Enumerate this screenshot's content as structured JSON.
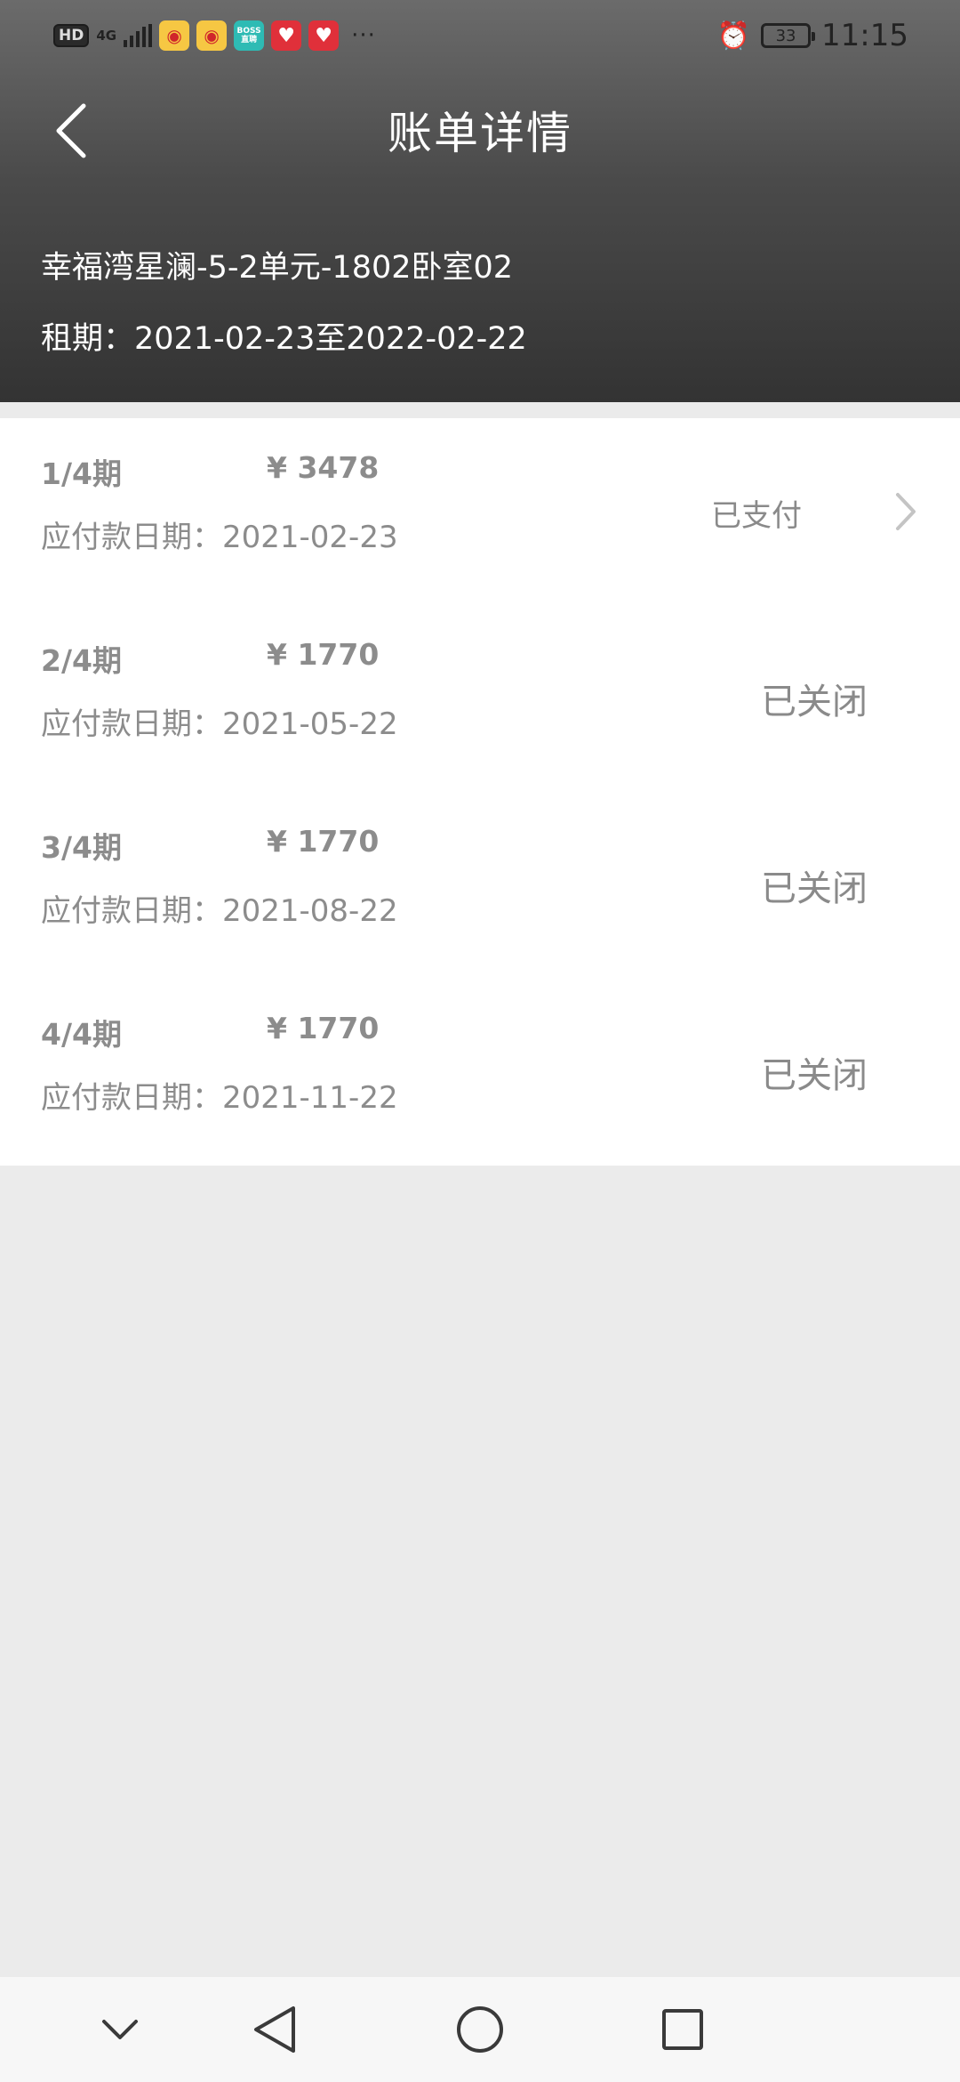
{
  "status_bar": {
    "hd": "HD",
    "network": "4G",
    "battery": "33",
    "time": "11:15",
    "more": "···",
    "boss_text": "BOSS\n直聘"
  },
  "header": {
    "title": "账单详情",
    "address": "幸福湾星澜-5-2单元-1802卧室02",
    "lease": "租期：2021-02-23至2022-02-22"
  },
  "bills": [
    {
      "period": "1/4期",
      "amount": "¥ 3478",
      "due": "应付款日期：2021-02-23",
      "status": "已支付"
    },
    {
      "period": "2/4期",
      "amount": "¥ 1770",
      "due": "应付款日期：2021-05-22",
      "status": "已关闭"
    },
    {
      "period": "3/4期",
      "amount": "¥ 1770",
      "due": "应付款日期：2021-08-22",
      "status": "已关闭"
    },
    {
      "period": "4/4期",
      "amount": "¥ 1770",
      "due": "应付款日期：2021-11-22",
      "status": "已关闭"
    }
  ],
  "colors": {
    "header_top": "#6b6b6b",
    "header_bottom": "#333333",
    "muted_text": "#8c8c8c",
    "page_bg": "#ebebeb"
  },
  "icons": {
    "back": "chevron-left-icon",
    "row_arrow": "chevron-right-icon",
    "nav_hide": "chevron-down-icon",
    "nav_back": "triangle-back-icon",
    "nav_home": "circle-home-icon",
    "nav_recent": "square-recent-icon"
  }
}
